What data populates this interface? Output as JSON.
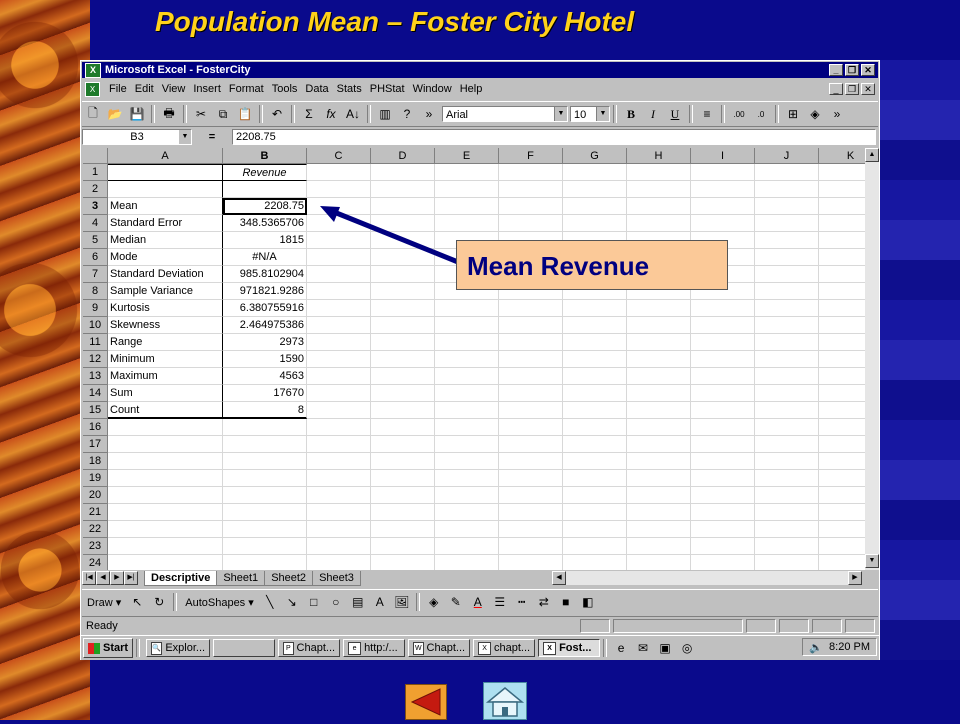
{
  "slide": {
    "title": "Population Mean – Foster City Hotel",
    "callout": "Mean Revenue"
  },
  "excel": {
    "title": "Microsoft Excel - FosterCity",
    "menu": [
      "File",
      "Edit",
      "View",
      "Insert",
      "Format",
      "Tools",
      "Data",
      "Stats",
      "PHStat",
      "Window",
      "Help"
    ],
    "font_name": "Arial",
    "font_size": "10",
    "name_box": "B3",
    "formula_eq": "=",
    "formula_value": "2208.75",
    "columns": [
      "A",
      "B",
      "C",
      "D",
      "E",
      "F",
      "G",
      "H",
      "I",
      "J",
      "K"
    ],
    "rows": [
      {
        "n": "1",
        "a": "",
        "b": "Revenue"
      },
      {
        "n": "2",
        "a": "",
        "b": ""
      },
      {
        "n": "3",
        "a": "Mean",
        "b": "2208.75"
      },
      {
        "n": "4",
        "a": "Standard Error",
        "b": "348.5365706"
      },
      {
        "n": "5",
        "a": "Median",
        "b": "1815"
      },
      {
        "n": "6",
        "a": "Mode",
        "b": "#N/A"
      },
      {
        "n": "7",
        "a": "Standard Deviation",
        "b": "985.8102904"
      },
      {
        "n": "8",
        "a": "Sample Variance",
        "b": "971821.9286"
      },
      {
        "n": "9",
        "a": "Kurtosis",
        "b": "6.380755916"
      },
      {
        "n": "10",
        "a": "Skewness",
        "b": "2.464975386"
      },
      {
        "n": "11",
        "a": "Range",
        "b": "2973"
      },
      {
        "n": "12",
        "a": "Minimum",
        "b": "1590"
      },
      {
        "n": "13",
        "a": "Maximum",
        "b": "4563"
      },
      {
        "n": "14",
        "a": "Sum",
        "b": "17670"
      },
      {
        "n": "15",
        "a": "Count",
        "b": "8"
      },
      {
        "n": "16",
        "a": "",
        "b": ""
      },
      {
        "n": "17",
        "a": "",
        "b": ""
      },
      {
        "n": "18",
        "a": "",
        "b": ""
      },
      {
        "n": "19",
        "a": "",
        "b": ""
      },
      {
        "n": "20",
        "a": "",
        "b": ""
      },
      {
        "n": "21",
        "a": "",
        "b": ""
      },
      {
        "n": "22",
        "a": "",
        "b": ""
      },
      {
        "n": "23",
        "a": "",
        "b": ""
      },
      {
        "n": "24",
        "a": "",
        "b": ""
      }
    ],
    "sheets": [
      "Descriptive",
      "Sheet1",
      "Sheet2",
      "Sheet3"
    ],
    "draw_label": "Draw",
    "autoshapes_label": "AutoShapes",
    "status": "Ready"
  },
  "taskbar": {
    "start": "Start",
    "items": [
      "Explor...",
      "",
      "Chapt...",
      "http:/...",
      "Chapt...",
      "chapt...",
      "Fost..."
    ],
    "time": "8:20 PM"
  }
}
